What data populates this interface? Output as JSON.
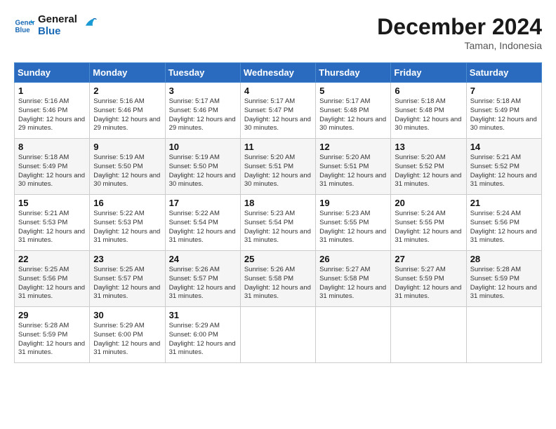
{
  "logo": {
    "line1": "General",
    "line2": "Blue"
  },
  "title": "December 2024",
  "location": "Taman, Indonesia",
  "days_header": [
    "Sunday",
    "Monday",
    "Tuesday",
    "Wednesday",
    "Thursday",
    "Friday",
    "Saturday"
  ],
  "weeks": [
    [
      {
        "day": "1",
        "sunrise": "5:16 AM",
        "sunset": "5:46 PM",
        "daylight": "12 hours and 29 minutes."
      },
      {
        "day": "2",
        "sunrise": "5:16 AM",
        "sunset": "5:46 PM",
        "daylight": "12 hours and 29 minutes."
      },
      {
        "day": "3",
        "sunrise": "5:17 AM",
        "sunset": "5:46 PM",
        "daylight": "12 hours and 29 minutes."
      },
      {
        "day": "4",
        "sunrise": "5:17 AM",
        "sunset": "5:47 PM",
        "daylight": "12 hours and 30 minutes."
      },
      {
        "day": "5",
        "sunrise": "5:17 AM",
        "sunset": "5:48 PM",
        "daylight": "12 hours and 30 minutes."
      },
      {
        "day": "6",
        "sunrise": "5:18 AM",
        "sunset": "5:48 PM",
        "daylight": "12 hours and 30 minutes."
      },
      {
        "day": "7",
        "sunrise": "5:18 AM",
        "sunset": "5:49 PM",
        "daylight": "12 hours and 30 minutes."
      }
    ],
    [
      {
        "day": "8",
        "sunrise": "5:18 AM",
        "sunset": "5:49 PM",
        "daylight": "12 hours and 30 minutes."
      },
      {
        "day": "9",
        "sunrise": "5:19 AM",
        "sunset": "5:50 PM",
        "daylight": "12 hours and 30 minutes."
      },
      {
        "day": "10",
        "sunrise": "5:19 AM",
        "sunset": "5:50 PM",
        "daylight": "12 hours and 30 minutes."
      },
      {
        "day": "11",
        "sunrise": "5:20 AM",
        "sunset": "5:51 PM",
        "daylight": "12 hours and 30 minutes."
      },
      {
        "day": "12",
        "sunrise": "5:20 AM",
        "sunset": "5:51 PM",
        "daylight": "12 hours and 31 minutes."
      },
      {
        "day": "13",
        "sunrise": "5:20 AM",
        "sunset": "5:52 PM",
        "daylight": "12 hours and 31 minutes."
      },
      {
        "day": "14",
        "sunrise": "5:21 AM",
        "sunset": "5:52 PM",
        "daylight": "12 hours and 31 minutes."
      }
    ],
    [
      {
        "day": "15",
        "sunrise": "5:21 AM",
        "sunset": "5:53 PM",
        "daylight": "12 hours and 31 minutes."
      },
      {
        "day": "16",
        "sunrise": "5:22 AM",
        "sunset": "5:53 PM",
        "daylight": "12 hours and 31 minutes."
      },
      {
        "day": "17",
        "sunrise": "5:22 AM",
        "sunset": "5:54 PM",
        "daylight": "12 hours and 31 minutes."
      },
      {
        "day": "18",
        "sunrise": "5:23 AM",
        "sunset": "5:54 PM",
        "daylight": "12 hours and 31 minutes."
      },
      {
        "day": "19",
        "sunrise": "5:23 AM",
        "sunset": "5:55 PM",
        "daylight": "12 hours and 31 minutes."
      },
      {
        "day": "20",
        "sunrise": "5:24 AM",
        "sunset": "5:55 PM",
        "daylight": "12 hours and 31 minutes."
      },
      {
        "day": "21",
        "sunrise": "5:24 AM",
        "sunset": "5:56 PM",
        "daylight": "12 hours and 31 minutes."
      }
    ],
    [
      {
        "day": "22",
        "sunrise": "5:25 AM",
        "sunset": "5:56 PM",
        "daylight": "12 hours and 31 minutes."
      },
      {
        "day": "23",
        "sunrise": "5:25 AM",
        "sunset": "5:57 PM",
        "daylight": "12 hours and 31 minutes."
      },
      {
        "day": "24",
        "sunrise": "5:26 AM",
        "sunset": "5:57 PM",
        "daylight": "12 hours and 31 minutes."
      },
      {
        "day": "25",
        "sunrise": "5:26 AM",
        "sunset": "5:58 PM",
        "daylight": "12 hours and 31 minutes."
      },
      {
        "day": "26",
        "sunrise": "5:27 AM",
        "sunset": "5:58 PM",
        "daylight": "12 hours and 31 minutes."
      },
      {
        "day": "27",
        "sunrise": "5:27 AM",
        "sunset": "5:59 PM",
        "daylight": "12 hours and 31 minutes."
      },
      {
        "day": "28",
        "sunrise": "5:28 AM",
        "sunset": "5:59 PM",
        "daylight": "12 hours and 31 minutes."
      }
    ],
    [
      {
        "day": "29",
        "sunrise": "5:28 AM",
        "sunset": "5:59 PM",
        "daylight": "12 hours and 31 minutes."
      },
      {
        "day": "30",
        "sunrise": "5:29 AM",
        "sunset": "6:00 PM",
        "daylight": "12 hours and 31 minutes."
      },
      {
        "day": "31",
        "sunrise": "5:29 AM",
        "sunset": "6:00 PM",
        "daylight": "12 hours and 31 minutes."
      },
      null,
      null,
      null,
      null
    ]
  ],
  "labels": {
    "sunrise_prefix": "Sunrise: ",
    "sunset_prefix": "Sunset: ",
    "daylight_prefix": "Daylight: "
  }
}
